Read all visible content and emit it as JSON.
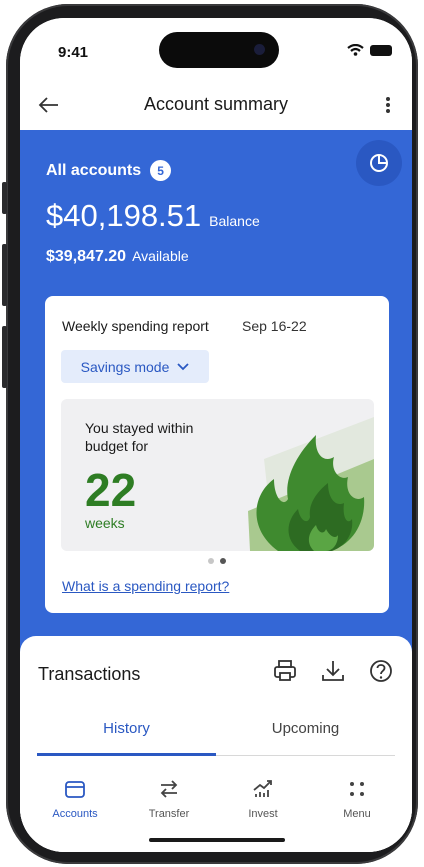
{
  "status_bar": {
    "time": "9:41"
  },
  "app_bar": {
    "title": "Account summary"
  },
  "hero": {
    "accounts_label": "All accounts",
    "accounts_count": "5",
    "balance_amount": "$40,198.51",
    "balance_label": "Balance",
    "available_amount": "$39,847.20",
    "available_label": "Available"
  },
  "report_card": {
    "title": "Weekly spending report",
    "date_range": "Sep 16-22",
    "mode_button": "Savings mode",
    "message": "You stayed within budget for",
    "weeks_value": "22",
    "weeks_label": "weeks",
    "pager": {
      "count": 2,
      "active_index": 1
    },
    "link": "What is a spending report?"
  },
  "transactions": {
    "title": "Transactions",
    "icons": [
      "print-icon",
      "download-icon",
      "help-icon"
    ],
    "tabs": [
      {
        "label": "History",
        "active": true
      },
      {
        "label": "Upcoming",
        "active": false
      }
    ]
  },
  "bottom_nav": [
    {
      "label": "Accounts",
      "icon": "wallet-icon",
      "active": true
    },
    {
      "label": "Transfer",
      "icon": "transfer-icon",
      "active": false
    },
    {
      "label": "Invest",
      "icon": "invest-icon",
      "active": false
    },
    {
      "label": "Menu",
      "icon": "menu-dots-icon",
      "active": false
    }
  ],
  "colors": {
    "brand_blue": "#3467d6",
    "accent_blue": "#2a58c2",
    "success_green": "#2e7d24",
    "chip_background": "#e4ecfb"
  }
}
